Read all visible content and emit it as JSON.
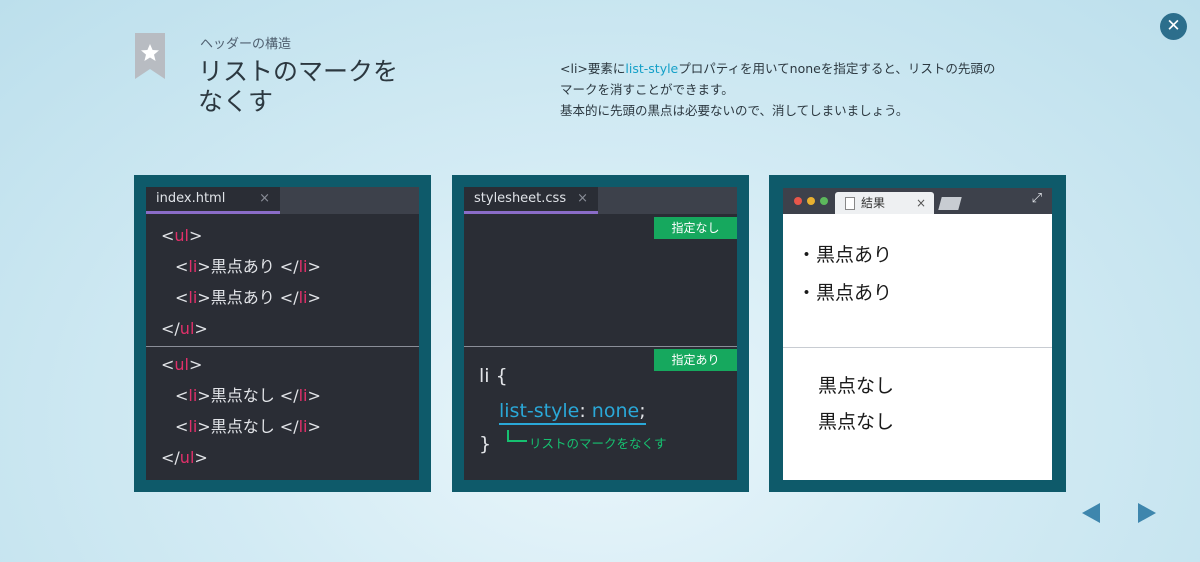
{
  "header": {
    "subtitle": "ヘッダーの構造",
    "title_line1": "リストのマークを",
    "title_line2": "なくす",
    "desc_part1": "<li>要素に",
    "desc_highlight": "list-style",
    "desc_part2": "プロパティを用いてnoneを指定すると、リストの先頭の",
    "desc_line2": "マークを消すことができます。",
    "desc_line3": "基本的に先頭の黒点は必要ないので、消してしまいましょう。"
  },
  "html_editor": {
    "tab": "index.html",
    "tab_close": "×",
    "tag_ul": "ul",
    "tag_li": "li",
    "item_with": "黒点あり",
    "item_without": "黒点なし"
  },
  "css_editor": {
    "tab": "stylesheet.css",
    "tab_close": "×",
    "badge_none": "指定なし",
    "badge_set": "指定あり",
    "selector": "li {",
    "property": "list-style",
    "colon": ":",
    "value": "none",
    "semicolon": ";",
    "close_brace": "}",
    "annotation": "リストのマークをなくす"
  },
  "result": {
    "tab": "結果",
    "tab_close": "×",
    "bullet": "・",
    "item_with": "黒点あり",
    "item_without": "黒点なし"
  },
  "colors": {
    "tag_red": "#e0306a",
    "css_blue": "#2aa8d8",
    "badge_green": "#16a85e",
    "panel_teal": "#0e5a6a"
  }
}
